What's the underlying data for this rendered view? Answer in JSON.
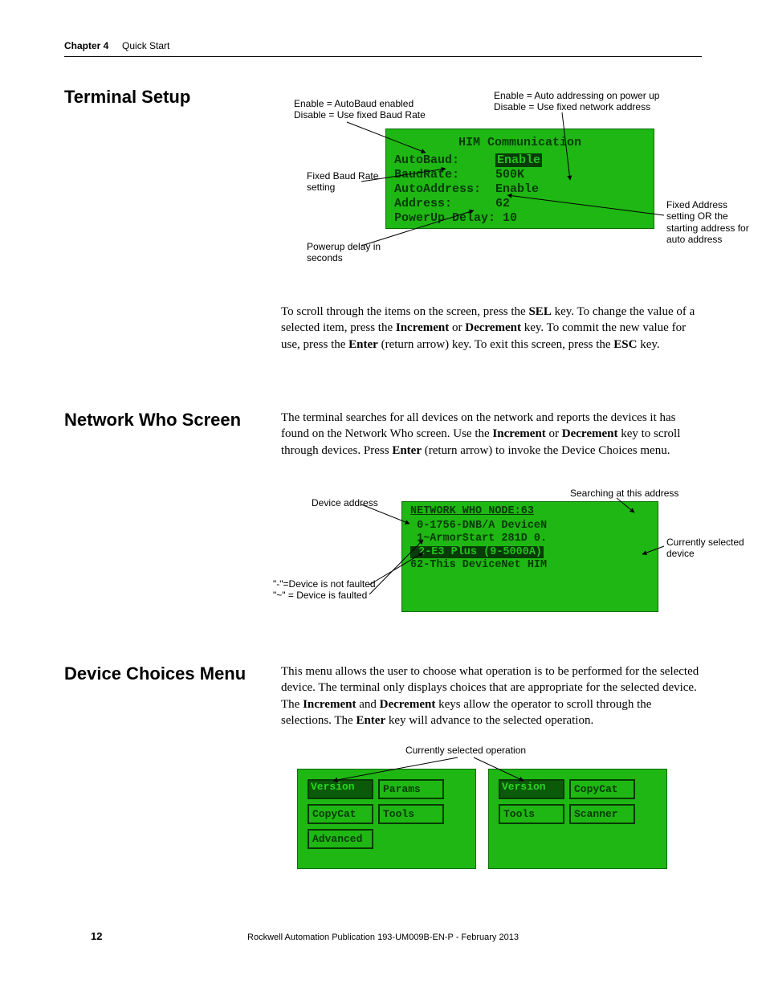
{
  "header": {
    "chapter_label": "Chapter 4",
    "chapter_title": "Quick Start"
  },
  "sections": {
    "terminal_setup": {
      "heading": "Terminal Setup",
      "body_html": "To scroll through the items on the screen, press the <b>SEL</b> key. To change the value of a selected item, press the <b>Increment</b> or <b>Decrement</b> key. To commit the new value for use, press the <b>Enter</b> (return arrow) key. To exit this screen, press the <b>ESC</b> key.",
      "callouts": {
        "autobaud": "Enable = AutoBaud enabled\nDisable = Use fixed Baud Rate",
        "autoaddr": "Enable = Auto addressing on power up\nDisable = Use fixed network address",
        "baudsetting": "Fixed Baud Rate setting",
        "powerup": "Powerup delay in seconds",
        "address": "Fixed Address setting OR the starting address for auto address"
      },
      "lcd": {
        "title": "HIM Communication",
        "rows": [
          {
            "label": "AutoBaud:",
            "value": "Enable",
            "selected": true
          },
          {
            "label": "BaudRate:",
            "value": "500K"
          },
          {
            "label": "AutoAddress:",
            "value": "Enable"
          },
          {
            "label": "Address:",
            "value": "62"
          },
          {
            "label": "PowerUp Delay:",
            "value": "10"
          }
        ]
      }
    },
    "network_who": {
      "heading": "Network Who Screen",
      "body_html": "The terminal searches for all devices on the network and reports the devices it has found on the Network Who screen. Use the <b>Increment</b> or <b>Decrement</b> key to scroll through devices. Press <b>Enter</b> (return arrow) to invoke the Device Choices menu.",
      "callouts": {
        "devaddr": "Device address",
        "searching": "Searching at this address",
        "faultlegend": "\"-\"=Device is not faulted\n\"~\" = Device is faulted",
        "selected": "Currently selected device"
      },
      "lcd": {
        "header_left": "NETWORK WHO",
        "header_right": "NODE:63",
        "rows": [
          {
            "addr": "0",
            "flag": "-",
            "name": "1756-DNB/A DeviceN"
          },
          {
            "addr": "1",
            "flag": "~",
            "name": "ArmorStart 281D 0."
          },
          {
            "addr": "2",
            "flag": "-",
            "name": "E3 Plus (9-5000A)",
            "selected": true
          },
          {
            "addr": "62",
            "flag": "-",
            "name": "This DeviceNet HIM"
          }
        ]
      }
    },
    "device_choices": {
      "heading": "Device Choices Menu",
      "body_html": "This menu allows the user to choose what operation is to be performed for the selected device. The terminal only displays choices that are appropriate for the selected device. The <b>Increment</b> and <b>Decrement</b> keys allow the operator to scroll through the selections. The <b>Enter</b> key will advance to the selected operation.",
      "callouts": {
        "selop": "Currently selected operation"
      },
      "menu_a": [
        "Version",
        "Params",
        "CopyCat",
        "Tools",
        "Advanced"
      ],
      "menu_b": [
        "Version",
        "CopyCat",
        "Tools",
        "Scanner"
      ],
      "selected_a": "Version",
      "selected_b": "Version"
    }
  },
  "footer": {
    "page": "12",
    "publication": "Rockwell Automation Publication 193-UM009B-EN-P - February 2013"
  }
}
